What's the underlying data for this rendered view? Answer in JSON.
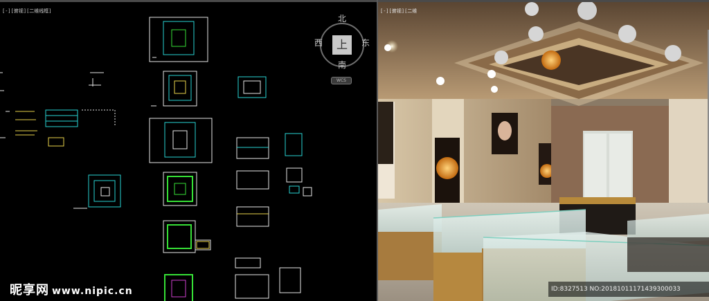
{
  "cad_viewport": {
    "label": "[-][俯视][二维线框]",
    "viewcube": {
      "north": "北",
      "south": "南",
      "west": "西",
      "east": "东",
      "top_face": "上",
      "wcs": "WCS"
    }
  },
  "render_viewport": {
    "label": "[-][俯视][二维"
  },
  "watermark": {
    "brand": "昵享网",
    "url": "www.nipic.cn"
  },
  "image_id": "ID:8327513 NO:20181011171439300033",
  "colors": {
    "cad_bg": "#000000",
    "cad_cyan": "#29d3d3",
    "cad_green": "#36e036",
    "cad_white": "#e8e8e8",
    "cad_yellow": "#e7d24a",
    "render_gold": "#c9a268"
  }
}
